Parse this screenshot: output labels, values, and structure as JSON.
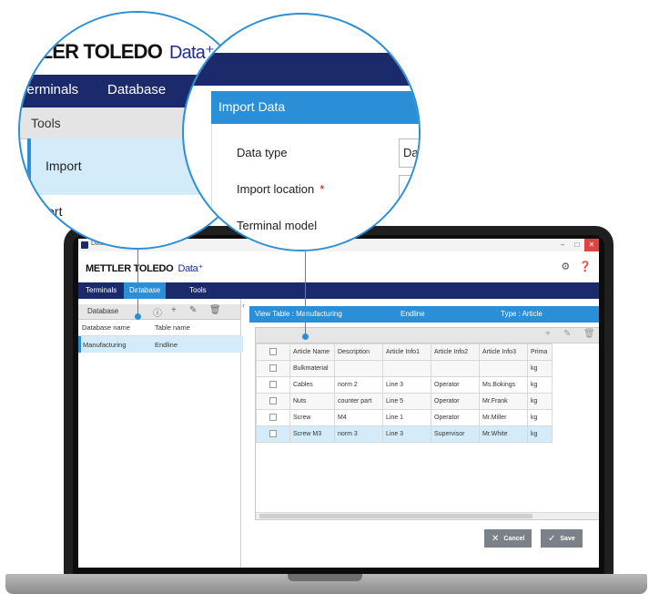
{
  "window": {
    "title": "Data+",
    "brand": "METTLER TOLEDO",
    "product": "Data⁺"
  },
  "nav": {
    "tabs": [
      {
        "label": "Terminals"
      },
      {
        "label": "Database"
      },
      {
        "label": "Tools"
      }
    ]
  },
  "left_panel": {
    "title": "Database",
    "columns": [
      "Database name",
      "Table name"
    ],
    "rows": [
      {
        "database": "Manufacturing",
        "table": "Endline"
      }
    ]
  },
  "view": {
    "title": "View Table : Manufacturing",
    "table": "Endline",
    "type": "Type : Article"
  },
  "grid": {
    "columns": [
      "Article Name",
      "Description",
      "Article Info1",
      "Article Info2",
      "Article Info3",
      "Prima"
    ],
    "rows": [
      {
        "name": "Bulkmaterial",
        "desc": "",
        "info1": "",
        "info2": "",
        "info3": "",
        "prim": "kg"
      },
      {
        "name": "Cables",
        "desc": "norm 2",
        "info1": "Line 3",
        "info2": "Operator",
        "info3": "Ms.Bokings",
        "prim": "kg"
      },
      {
        "name": "Nuts",
        "desc": "counter part",
        "info1": "Line 5",
        "info2": "Operator",
        "info3": "Mr.Frank",
        "prim": "kg"
      },
      {
        "name": "Screw",
        "desc": "M4",
        "info1": "Line 1",
        "info2": "Operator",
        "info3": "Mr.Miller",
        "prim": "kg"
      },
      {
        "name": "Screw M3",
        "desc": "norm 3",
        "info1": "Line 3",
        "info2": "Supervisor",
        "info3": "Mr.White",
        "prim": "kg"
      }
    ]
  },
  "actions": {
    "cancel": "Cancel",
    "save": "Save"
  },
  "zoom_left": {
    "brand": "TLER TOLEDO",
    "product": "Data⁺",
    "tab_terminals": "Terminals",
    "tab_database": "Database",
    "tools": "Tools",
    "import": "Import",
    "export": "Export"
  },
  "zoom_right": {
    "header": "Import Data",
    "data_type": "Data type",
    "import_location": "Import location",
    "required": "*",
    "terminal_model": "Terminal model",
    "data_type_value": "Data"
  },
  "colors": {
    "navy": "#1b2a6b",
    "accent": "#2a8fd6",
    "selection": "#d4ecfa"
  }
}
